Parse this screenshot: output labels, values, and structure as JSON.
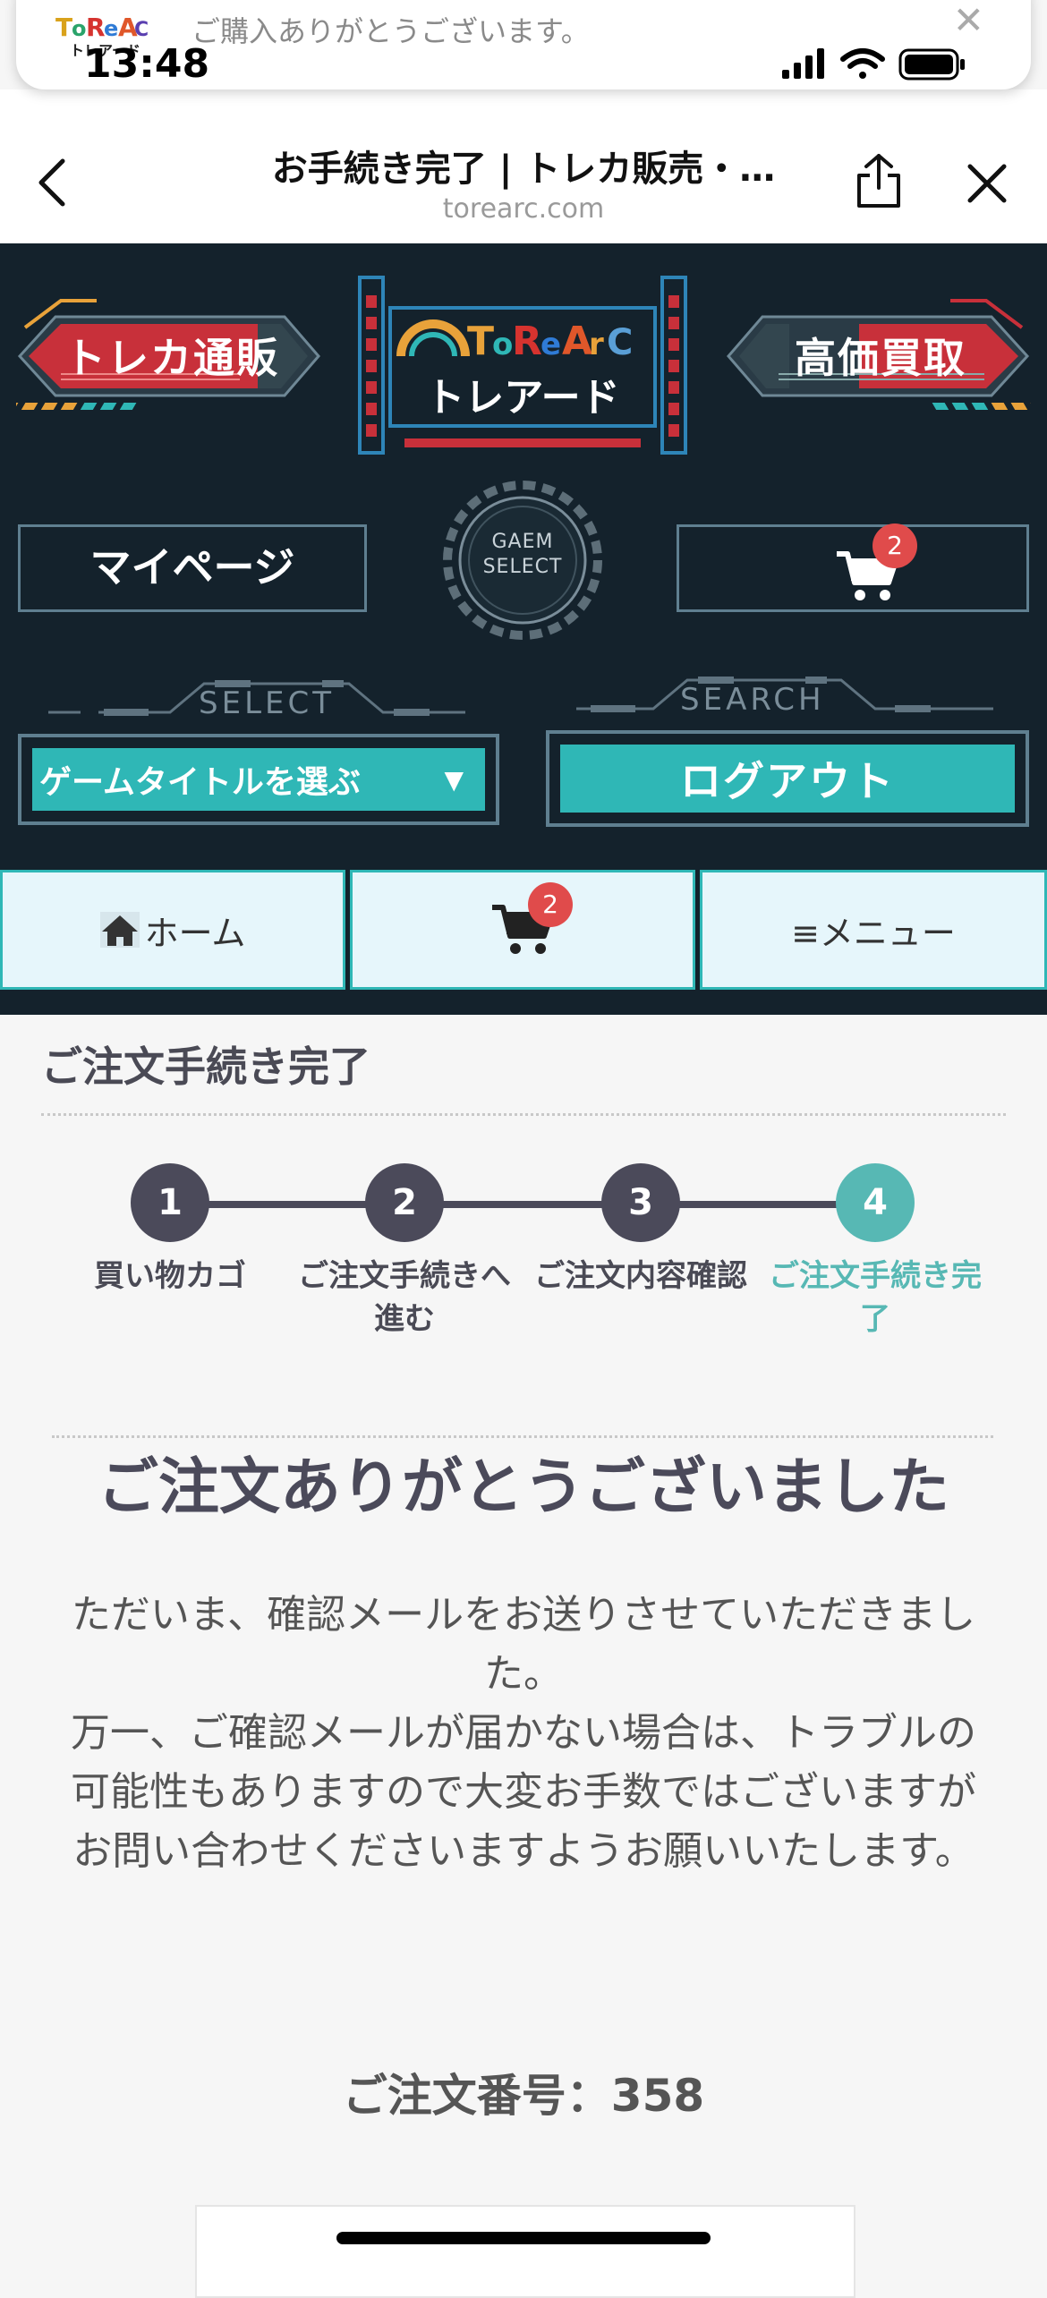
{
  "notification": {
    "message": "ご購入ありがとうございます。",
    "logo_text": "ToReArC",
    "logo_sub": "トレアード"
  },
  "status_bar": {
    "time": "13:48"
  },
  "browser": {
    "page_title": "お手続き完了 | トレカ販売・…",
    "host": "torearc.com"
  },
  "site_header": {
    "left_banner": "トレカ通販",
    "right_banner": "高価買取",
    "logo_text": "ToReArC",
    "logo_sub": "トレアード",
    "mypage_label": "マイページ",
    "cart_badge": "2",
    "game_select_line1": "GAEM",
    "game_select_line2": "SELECT",
    "select_deco": "SELECT",
    "search_deco": "SEARCH",
    "game_title_select": "ゲームタイトルを選ぶ",
    "logout_label": "ログアウト"
  },
  "nav": {
    "home_label": "ホーム",
    "cart_badge": "2",
    "menu_label": "≡メニュー"
  },
  "content": {
    "section_title": "ご注文手続き完了",
    "steps": [
      {
        "num": "1",
        "label": "買い物カゴ"
      },
      {
        "num": "2",
        "label": "ご注文手続きへ進む"
      },
      {
        "num": "3",
        "label": "ご注文内容確認"
      },
      {
        "num": "4",
        "label": "ご注文手続き完了"
      }
    ],
    "active_step": 4,
    "thanks": "ご注文ありがとうございました",
    "message": "ただいま、確認メールをお送りさせていただきました。\n万一、ご確認メールが届かない場合は、トラブルの可能性もありますので大変お手数ではございますがお問い合わせくださいますようお願いいたします。",
    "order_number": "ご注文番号：358"
  },
  "colors": {
    "dark_bg": "#14222c",
    "teal": "#2fb7b6",
    "step_dark": "#4b4a5a",
    "step_active": "#57b8b4",
    "red": "#c8303a",
    "badge": "#e04b4b"
  }
}
